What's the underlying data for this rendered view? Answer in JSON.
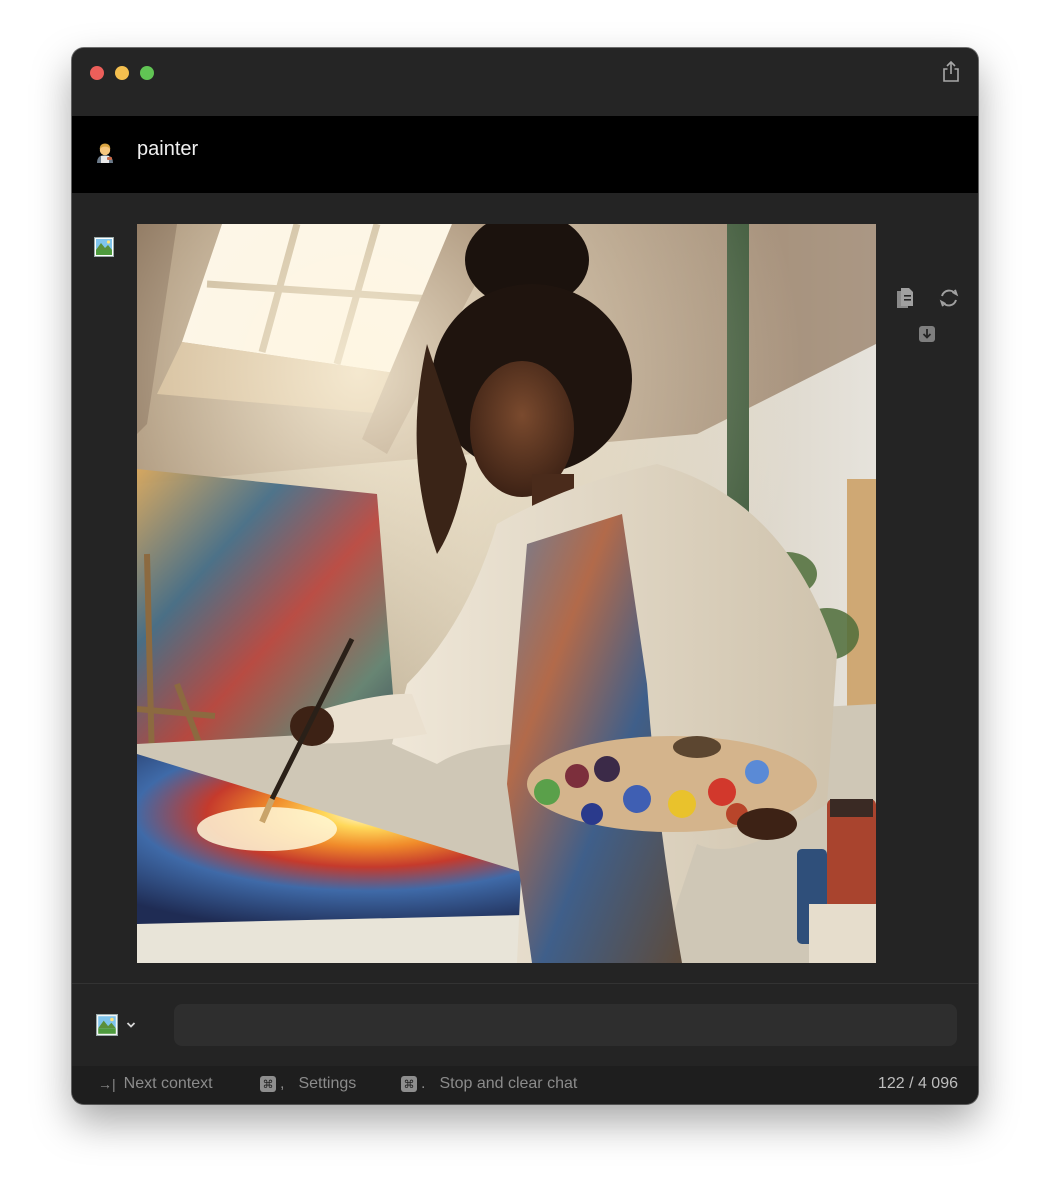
{
  "window": {
    "traffic_lights": [
      {
        "name": "close",
        "color": "#ec5f5a"
      },
      {
        "name": "minimize",
        "color": "#f4bf4f"
      },
      {
        "name": "zoom",
        "color": "#61c454"
      }
    ],
    "share_icon": "share-icon"
  },
  "header": {
    "avatar_icon": "painter-emoji-icon",
    "title": "painter"
  },
  "message": {
    "sender_icon": "image-generation-icon",
    "image": "generated-painting-image",
    "actions": {
      "copy_icon": "copy-icon",
      "regenerate_icon": "regenerate-icon",
      "download_icon": "download-icon"
    }
  },
  "composer": {
    "model_icon": "image-generation-icon",
    "dropdown_icon": "chevron-down-icon",
    "input_value": "",
    "input_placeholder": ""
  },
  "statusbar": {
    "next_context": {
      "key": "→|",
      "label": "Next context"
    },
    "settings": {
      "key": "⌘",
      "punct": ",",
      "label": "Settings"
    },
    "stop": {
      "key": "⌘",
      "punct": ".",
      "label": "Stop and clear chat"
    },
    "token_count": "122 / 4 096"
  },
  "colors": {
    "background": "#222222",
    "header": "#000000",
    "input": "#2e2e2e",
    "status_text": "#8b8b8b"
  }
}
